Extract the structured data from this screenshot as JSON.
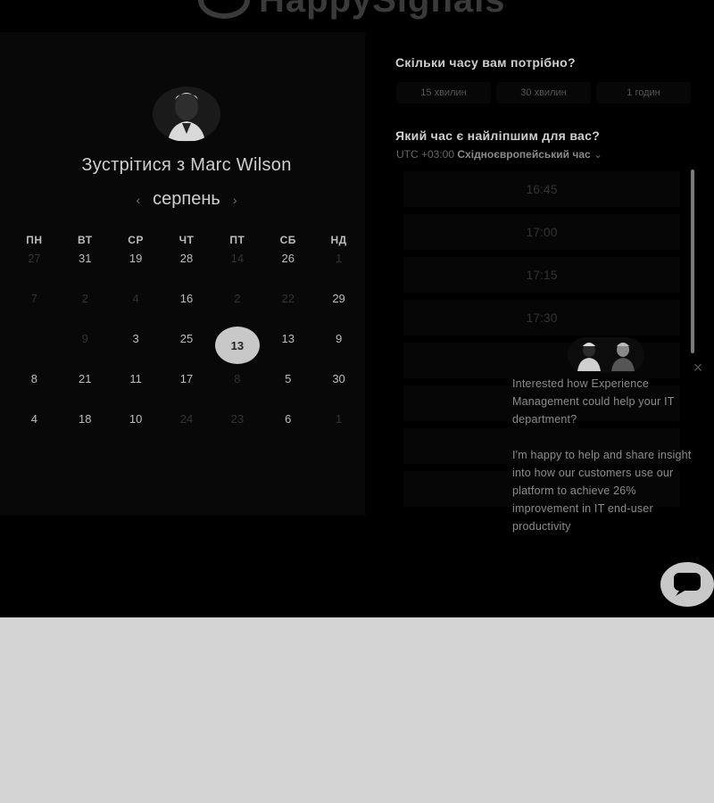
{
  "brand": {
    "logo_text": "HappySignals"
  },
  "calendar": {
    "title": "Зустрітися з Marc Wilson",
    "month": "серпень",
    "prev_icon": "chevron-left-icon",
    "next_icon": "chevron-right-icon",
    "weekdays": [
      "ПН",
      "ВТ",
      "СР",
      "ЧТ",
      "ПТ",
      "СБ",
      "НД"
    ],
    "days": [
      {
        "label": "27",
        "dim": true
      },
      {
        "label": "31",
        "dim": false
      },
      {
        "label": "19",
        "dim": false
      },
      {
        "label": "28",
        "dim": false
      },
      {
        "label": "14",
        "dim": true
      },
      {
        "label": "26",
        "dim": false
      },
      {
        "label": "1",
        "dim": true
      },
      {
        "label": "7",
        "dim": true
      },
      {
        "label": "2",
        "dim": true
      },
      {
        "label": "4",
        "dim": true
      },
      {
        "label": "16",
        "dim": false
      },
      {
        "label": "2",
        "dim": true
      },
      {
        "label": "22",
        "dim": true
      },
      {
        "label": "29",
        "dim": false
      },
      {
        "label": "",
        "dim": true
      },
      {
        "label": "9",
        "dim": true
      },
      {
        "label": "3",
        "dim": false
      },
      {
        "label": "25",
        "dim": false
      },
      {
        "label": "13",
        "dim": false,
        "selected": true
      },
      {
        "label": "13",
        "dim": false
      },
      {
        "label": "9",
        "dim": false
      },
      {
        "label": "8",
        "dim": false
      },
      {
        "label": "21",
        "dim": false
      },
      {
        "label": "11",
        "dim": false
      },
      {
        "label": "17",
        "dim": false
      },
      {
        "label": "8",
        "dim": true
      },
      {
        "label": "5",
        "dim": false
      },
      {
        "label": "30",
        "dim": false
      },
      {
        "label": "4",
        "dim": false
      },
      {
        "label": "18",
        "dim": false
      },
      {
        "label": "10",
        "dim": false
      },
      {
        "label": "24",
        "dim": true
      },
      {
        "label": "23",
        "dim": true
      },
      {
        "label": "6",
        "dim": false
      },
      {
        "label": "1",
        "dim": true
      }
    ]
  },
  "booking": {
    "duration_question": "Скільки часу вам потрібно?",
    "durations": [
      "15 хвилин",
      "30 хвилин",
      "1 годин"
    ],
    "time_question": "Який час є найліпшим для вас?",
    "timezone_prefix": "UTC +03:00",
    "timezone_name": "Східноєвропейський час",
    "timezone_chevron": "chevron-down-icon",
    "slots": [
      "16:45",
      "17:00",
      "17:15",
      "17:30",
      "",
      "",
      "",
      ""
    ]
  },
  "chat": {
    "message_1": "Interested how Experience Management could help your IT department?",
    "message_2": "I'm happy to help and share insight into how our customers use our platform to achieve 26% improvement in IT end-user productivity",
    "close_icon": "close-icon",
    "launcher_icon": "chat-bubble-icon"
  }
}
